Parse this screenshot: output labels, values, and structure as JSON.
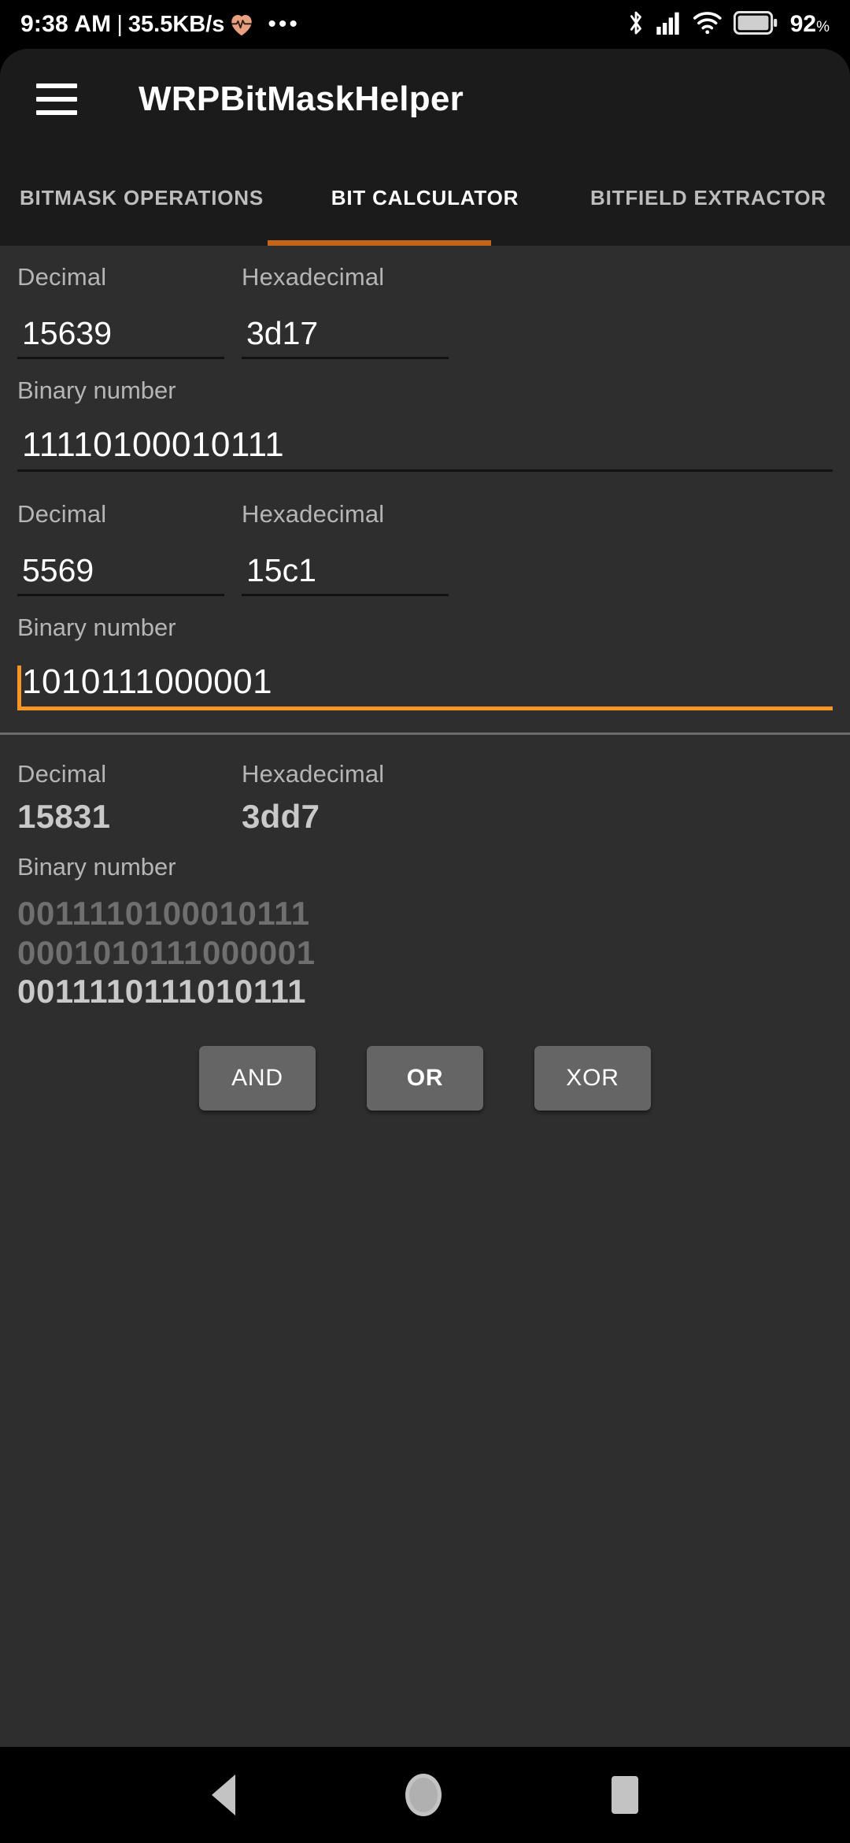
{
  "statusbar": {
    "time": "9:38 AM",
    "separator": "|",
    "network_rate": "35.5KB/s",
    "heart_icon": "heart-rate-icon",
    "overflow_dots": "•••",
    "bluetooth_icon": "bluetooth-icon",
    "signal_icon": "cellular-signal-icon",
    "wifi_icon": "wifi-icon",
    "battery_icon": "battery-icon",
    "battery_percent": "92",
    "battery_unit": "%"
  },
  "appbar": {
    "menu_icon": "hamburger-menu-icon",
    "title": "WRPBitMaskHelper"
  },
  "tabs": {
    "items": [
      {
        "label": "BITMASK OPERATIONS",
        "active": false
      },
      {
        "label": "BIT CALCULATOR",
        "active": true
      },
      {
        "label": "BITFIELD EXTRACTOR",
        "active": false
      }
    ],
    "indicator_color": "#c4651a"
  },
  "operand1": {
    "decimal_label": "Decimal",
    "decimal_value": "15639",
    "hex_label": "Hexadecimal",
    "hex_value": "3d17",
    "binary_label": "Binary number",
    "binary_value": "11110100010111"
  },
  "operand2": {
    "decimal_label": "Decimal",
    "decimal_value": "5569",
    "hex_label": "Hexadecimal",
    "hex_value": "15c1",
    "binary_label": "Binary number",
    "binary_value": "1010111000001",
    "focused": true,
    "focus_color": "#f59625"
  },
  "result": {
    "decimal_label": "Decimal",
    "decimal_value": "15831",
    "hex_label": "Hexadecimal",
    "hex_value": "3dd7",
    "binary_label": "Binary number",
    "operand1_binary": "0011110100010111",
    "operand2_binary": "0001010111000001",
    "result_binary": "0011110111010111"
  },
  "operations": {
    "buttons": [
      {
        "label": "AND",
        "selected": false
      },
      {
        "label": "OR",
        "selected": true
      },
      {
        "label": "XOR",
        "selected": false
      }
    ]
  },
  "navbar": {
    "back_icon": "back-triangle-icon",
    "home_icon": "home-circle-icon",
    "recents_icon": "recents-square-icon"
  }
}
